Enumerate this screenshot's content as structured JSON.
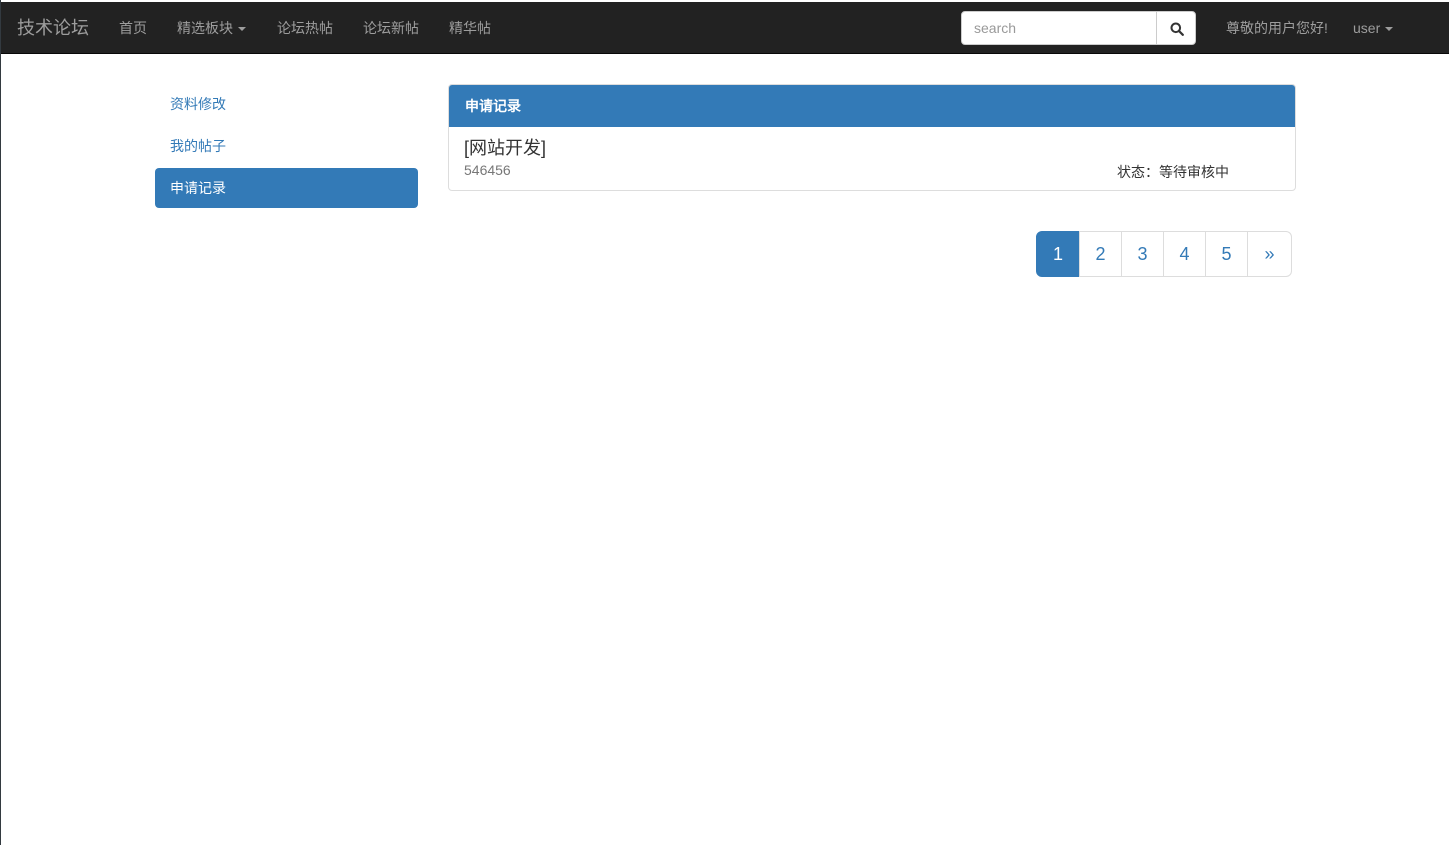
{
  "navbar": {
    "brand": "技术论坛",
    "items": [
      {
        "label": "首页"
      },
      {
        "label": "精选板块"
      },
      {
        "label": "论坛热帖"
      },
      {
        "label": "论坛新帖"
      },
      {
        "label": "精华帖"
      }
    ],
    "search": {
      "placeholder": "search",
      "icon": "search-icon"
    },
    "greeting": "尊敬的用户您好!",
    "user_label": "user"
  },
  "sidebar": {
    "items": [
      {
        "label": "资料修改"
      },
      {
        "label": "我的帖子"
      },
      {
        "label": "申请记录"
      }
    ],
    "active_index": 2
  },
  "panel": {
    "heading": "申请记录",
    "entries": [
      {
        "title": "[网站开发]",
        "content": "546456",
        "status": "状态：等待审核中"
      }
    ]
  },
  "pagination": {
    "pages": [
      "1",
      "2",
      "3",
      "4",
      "5"
    ],
    "next": "»",
    "active": "1"
  },
  "colors": {
    "navbar_bg": "#222222",
    "primary": "#337ab7",
    "nav_text": "#9d9d9d"
  }
}
